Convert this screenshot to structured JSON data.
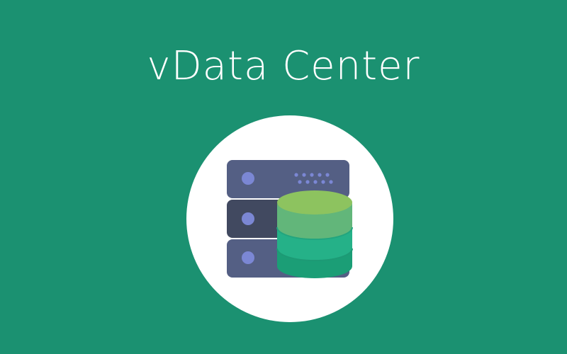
{
  "banner": {
    "title": "vData Center",
    "background_color": "#1b9171",
    "icon": "database-server-icon",
    "colors": {
      "server_light": "#545f84",
      "server_dark": "#414960",
      "server_accent": "#7b87d4",
      "db_top": "#8dc35f",
      "db_layer_1": "#62b67a",
      "db_layer_2": "#25b188",
      "db_layer_3": "#1b9e76"
    }
  }
}
